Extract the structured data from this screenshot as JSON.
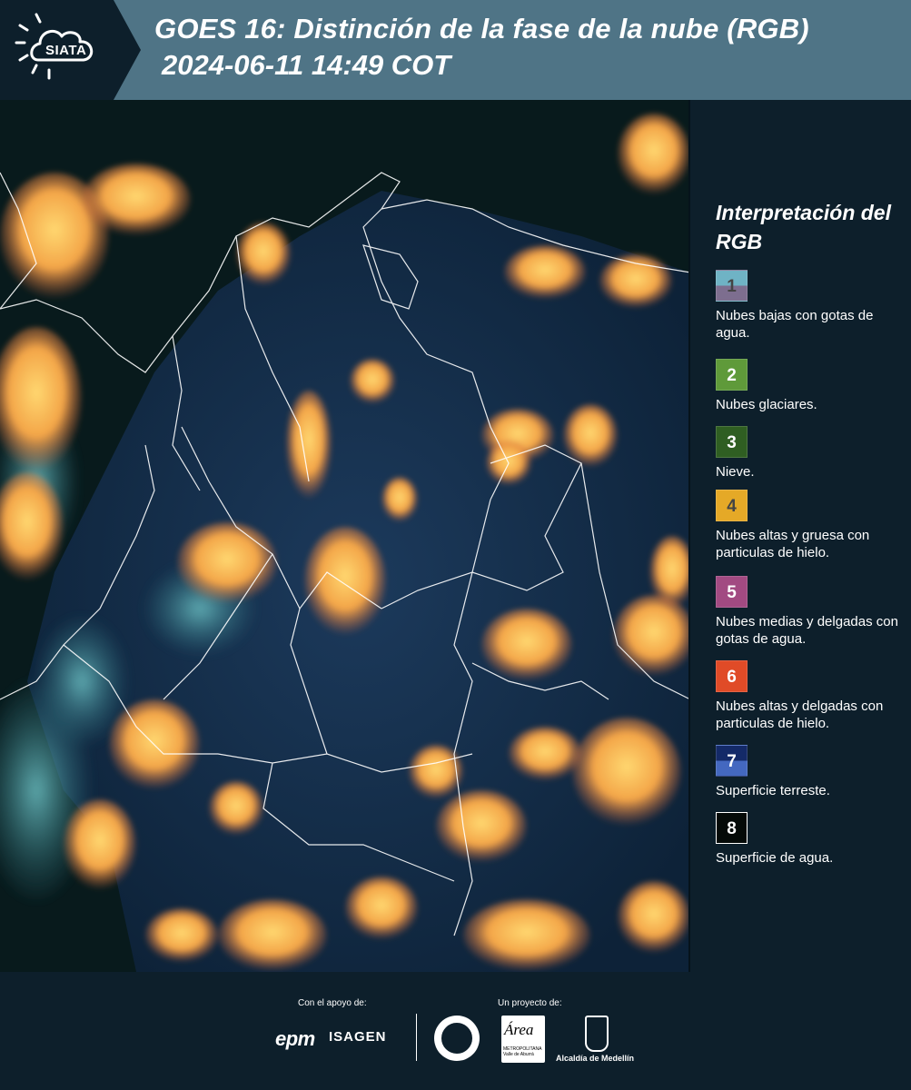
{
  "header": {
    "logo_text": "SIATA",
    "title_line1": "GOES 16: Distinción de la fase de la nube (RGB)",
    "title_line2": "2024-06-11 14:49 COT",
    "background_color": "#4f7486"
  },
  "legend": {
    "title": "Interpretación del RGB",
    "items": [
      {
        "num": "1",
        "label": "Nubes bajas con gotas de agua.",
        "color_top": "#6fb3c5",
        "color_bottom": "#7d6e8f"
      },
      {
        "num": "2",
        "label": "Nubes glaciares.",
        "color_top": "#5f9a3a",
        "color_bottom": "#5f9a3a"
      },
      {
        "num": "3",
        "label": "Nieve.",
        "color_top": "#2f5e22",
        "color_bottom": "#2f5e22"
      },
      {
        "num": "4",
        "label": "Nubes altas y gruesa con particulas de hielo.",
        "color_top": "#e5a927",
        "color_bottom": "#e5a927"
      },
      {
        "num": "5",
        "label": "Nubes medias y delgadas con gotas de agua.",
        "color_top": "#a24a82",
        "color_bottom": "#a24a82"
      },
      {
        "num": "6",
        "label": "Nubes altas y delgadas con particulas de hielo.",
        "color_top": "#e04b27",
        "color_bottom": "#e04b27"
      },
      {
        "num": "7",
        "label": "Superficie terreste.",
        "color_top": "#142a68",
        "color_bottom": "#4468c0"
      },
      {
        "num": "8",
        "label": "Superficie de agua.",
        "color_top": "#050a08",
        "color_bottom": "#050a08"
      }
    ]
  },
  "footer": {
    "support_caption": "Con el apoyo de:",
    "project_caption": "Un proyecto de:",
    "epm": "epm",
    "isagen": "ISAGEN",
    "area_logo": "Área",
    "area_logo_sub": "METROPOLITANA Valle de Aburrá",
    "medellin": "Alcaldía de Medellín"
  }
}
